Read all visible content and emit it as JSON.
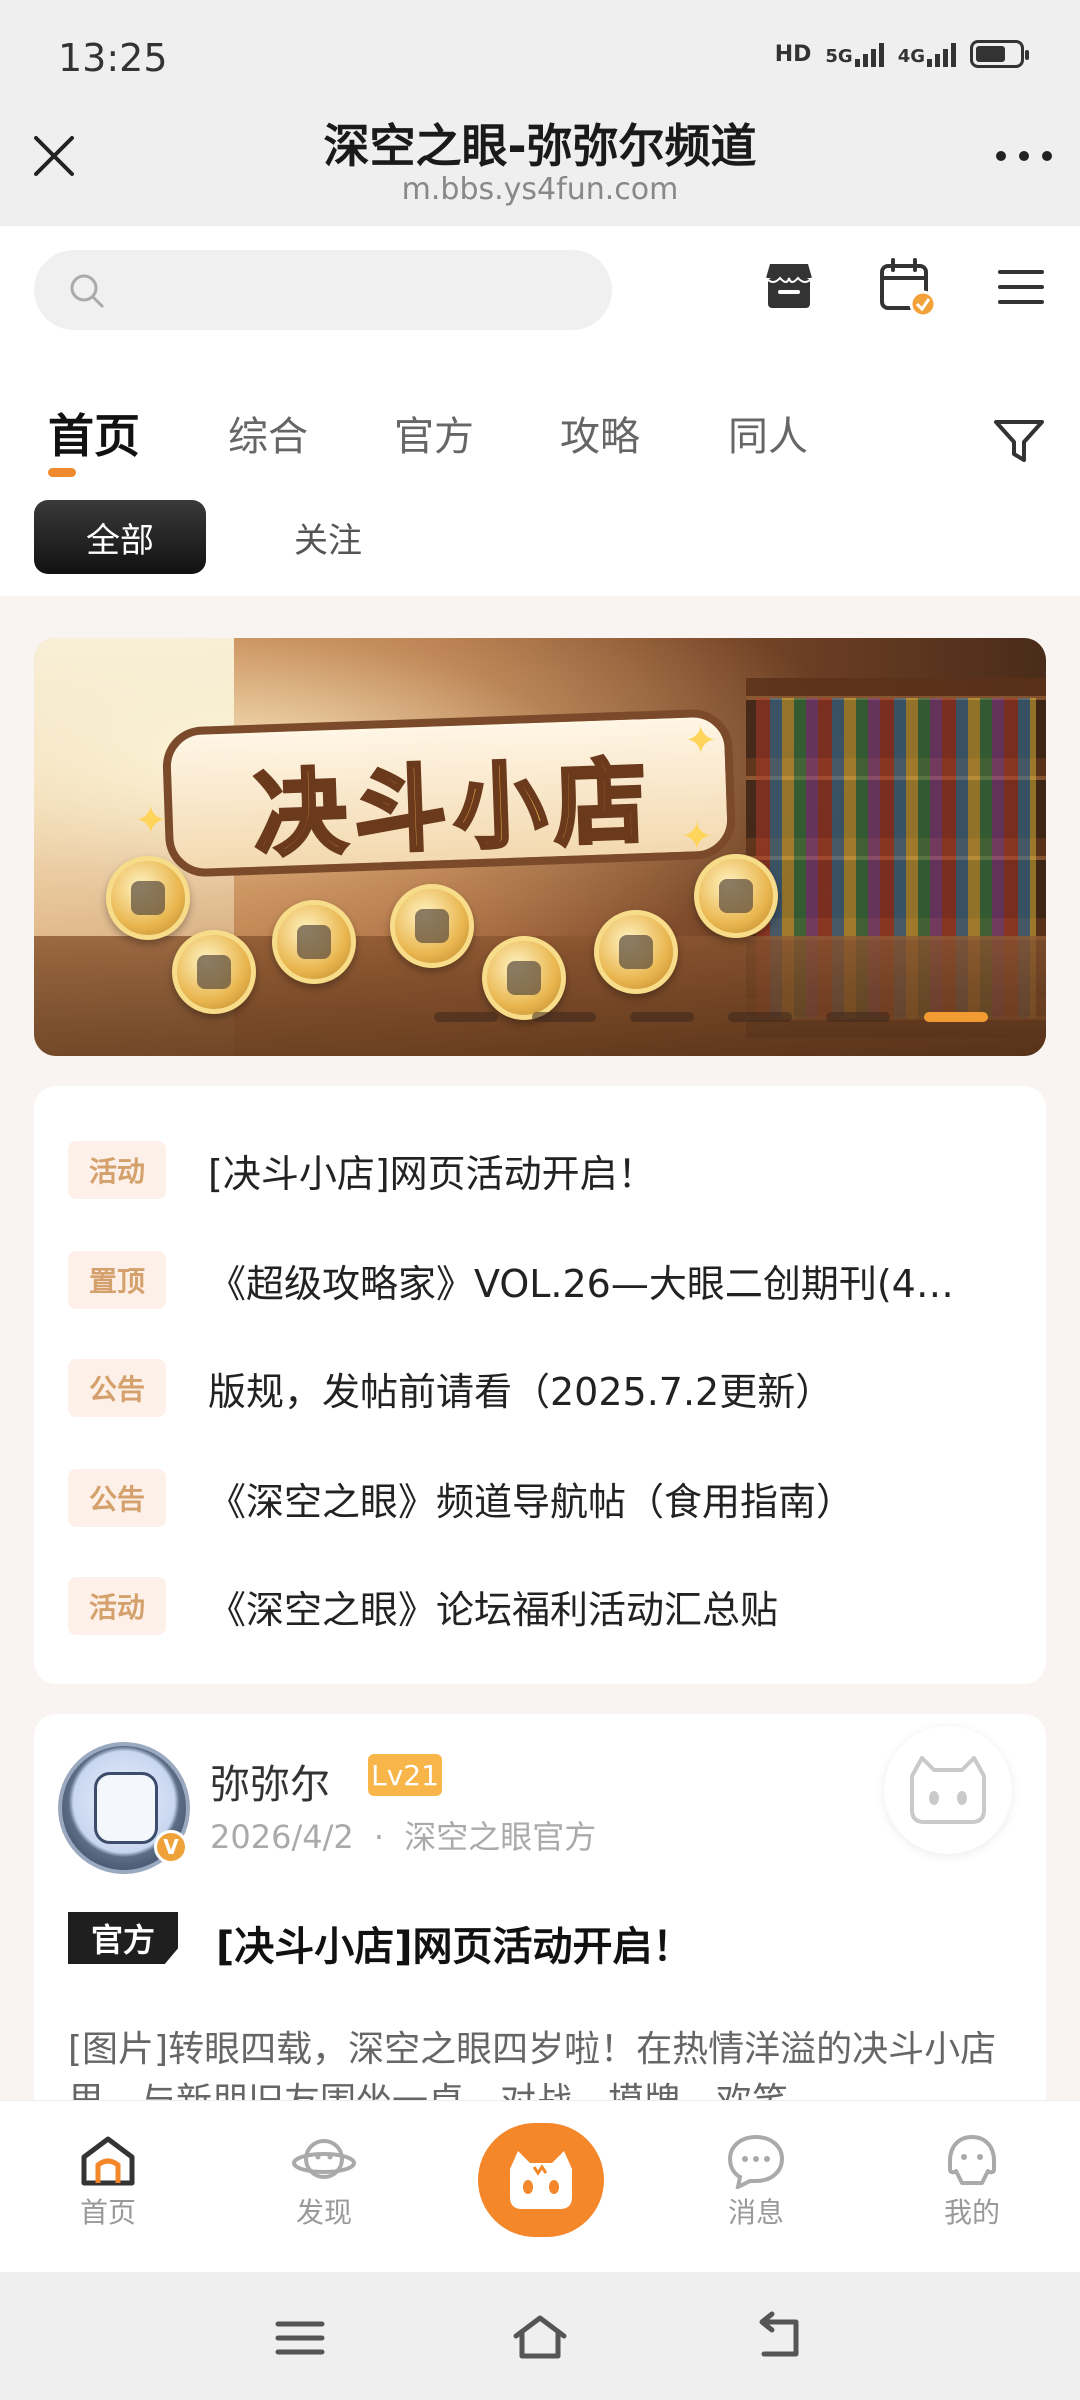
{
  "status_bar": {
    "time": "13:25",
    "hd": "HD",
    "network_5g": "5G",
    "network_4g": "4G"
  },
  "title_bar": {
    "title": "深空之眼-弥弥尔频道",
    "url": "m.bbs.ys4fun.com"
  },
  "search": {
    "placeholder": ""
  },
  "tabs": [
    {
      "label": "首页",
      "active": true
    },
    {
      "label": "综合",
      "active": false
    },
    {
      "label": "官方",
      "active": false
    },
    {
      "label": "攻略",
      "active": false
    },
    {
      "label": "同人",
      "active": false
    }
  ],
  "sub_tabs": [
    {
      "label": "全部",
      "active": true
    },
    {
      "label": "关注",
      "active": false
    }
  ],
  "banner": {
    "title": "决斗小店",
    "slide_count": 6,
    "active_slide": 6
  },
  "pinned": [
    {
      "tag": "活动",
      "text": "[决斗小店]网页活动开启！"
    },
    {
      "tag": "置顶",
      "text": "《超级攻略家》VOL.26—大眼二创期刊(4…"
    },
    {
      "tag": "公告",
      "text": "版规，发帖前请看（2025.7.2更新）"
    },
    {
      "tag": "公告",
      "text": "《深空之眼》频道导航帖（食用指南）"
    },
    {
      "tag": "活动",
      "text": "《深空之眼》论坛福利活动汇总贴"
    }
  ],
  "post": {
    "author": "弥弥尔",
    "level": "Lv21",
    "date": "2026/4/2",
    "source": "深空之眼官方",
    "meta_separator": "·",
    "tag": "官方",
    "title": "[决斗小店]网页活动开启！",
    "excerpt": "[图片]转眼四载，深空之眼四岁啦！在热情洋溢的决斗小店里，与新朋旧友围坐一桌，对战、摸牌、欢笑…"
  },
  "bottom_nav": [
    {
      "label": "首页",
      "icon": "home-icon"
    },
    {
      "label": "发现",
      "icon": "planet-icon"
    },
    {
      "label": "",
      "icon": "mascot-icon"
    },
    {
      "label": "消息",
      "icon": "message-icon"
    },
    {
      "label": "我的",
      "icon": "profile-icon"
    }
  ],
  "colors": {
    "accent": "#f3872a",
    "tag_text": "#d4a06c",
    "tag_bg": "#fdf0e8",
    "level_bg": "#f7b54a"
  }
}
